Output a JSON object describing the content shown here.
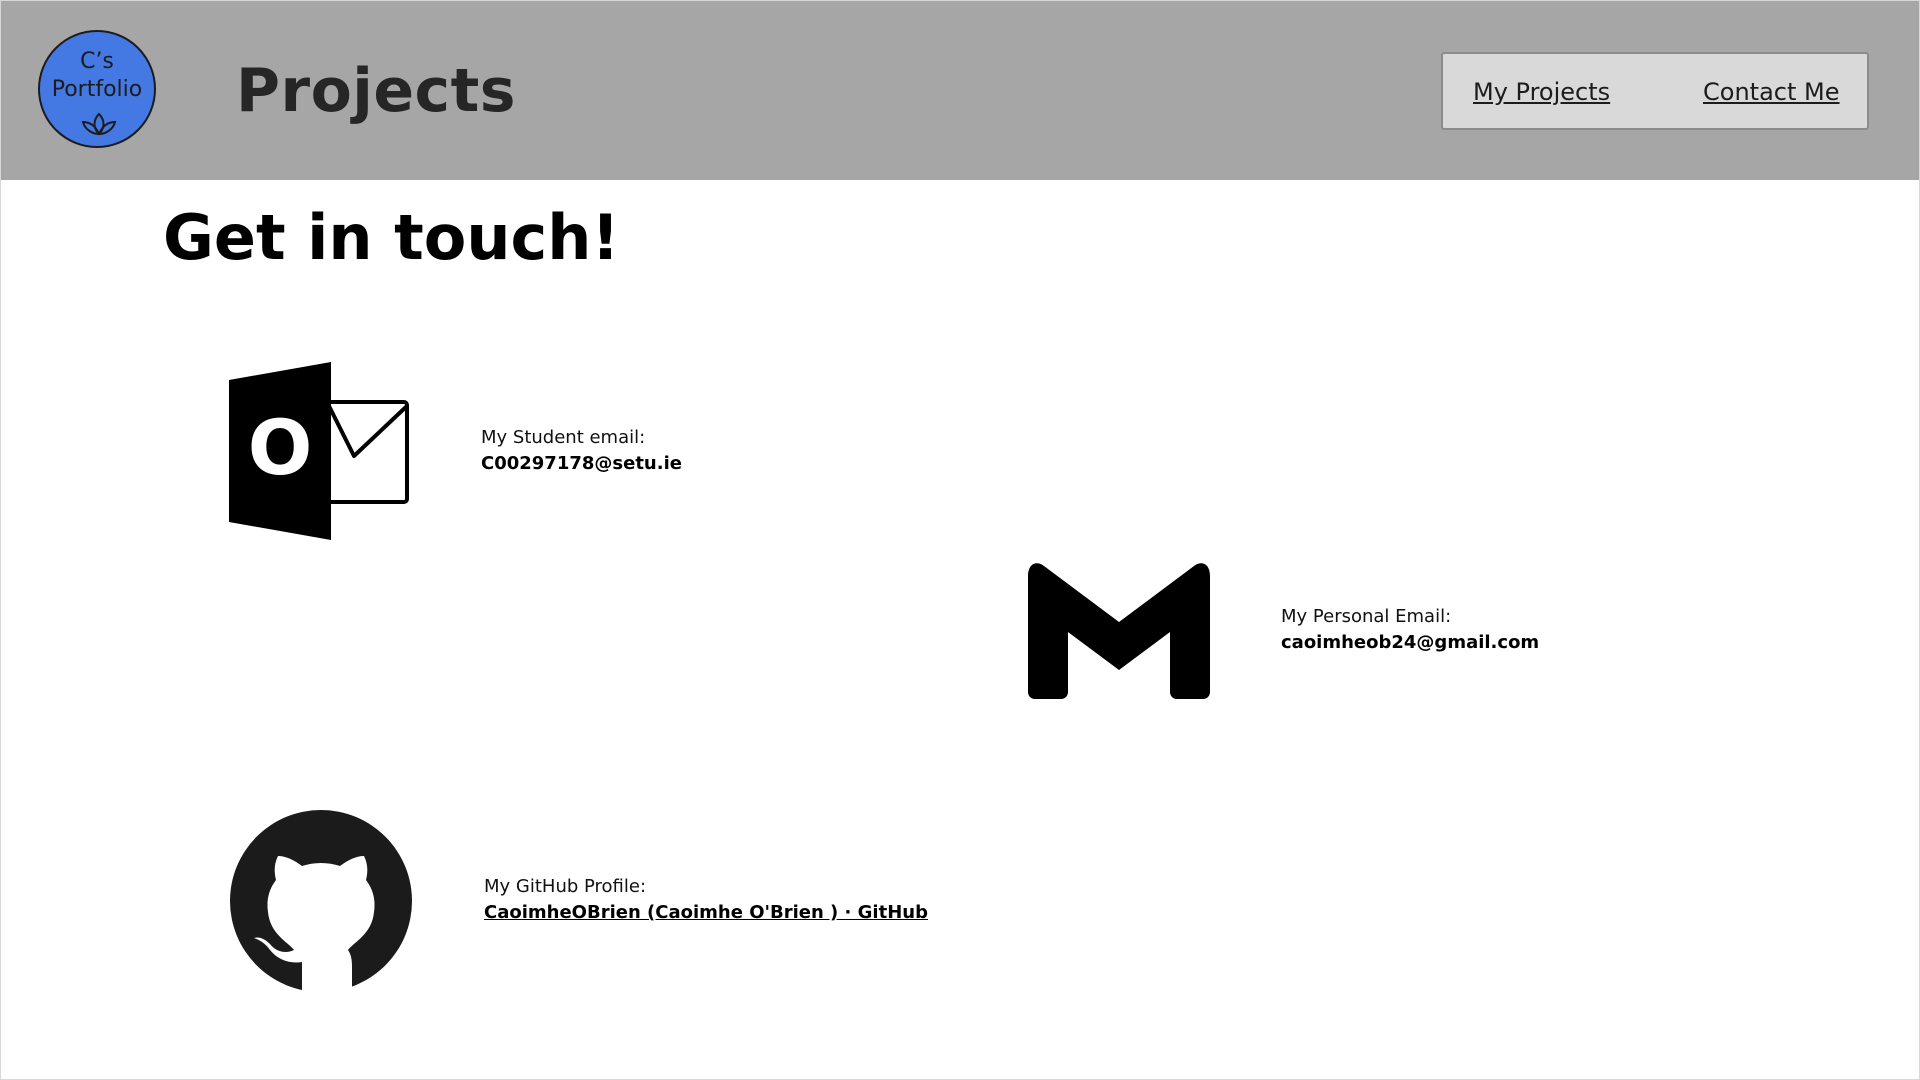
{
  "header": {
    "logo_line1": "C’s",
    "logo_line2": "Portfolio",
    "title": "Projects",
    "nav": {
      "projects_label": "My Projects",
      "contact_label": "Contact Me"
    }
  },
  "main": {
    "heading": "Get in touch!",
    "contacts": [
      {
        "icon": "outlook-icon",
        "label": "My Student email:",
        "value": "C00297178@setu.ie"
      },
      {
        "icon": "gmail-icon",
        "label": "My Personal Email:",
        "value": "caoimheob24@gmail.com"
      },
      {
        "icon": "github-icon",
        "label": "My GitHub Profile:",
        "value": "CaoimheOBrien (Caoimhe O'Brien ) · GitHub"
      }
    ]
  },
  "colors": {
    "header_bg": "#a6a6a6",
    "logo_bg": "#4479e3",
    "nav_bg": "#d9d9d9",
    "page_bg": "#ffffff"
  }
}
